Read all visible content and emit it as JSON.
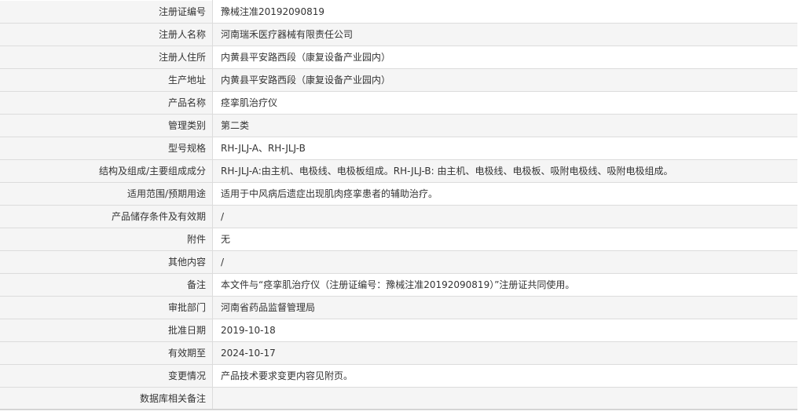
{
  "rows": [
    {
      "label": "注册证编号",
      "value": "豫械注准20192090819"
    },
    {
      "label": "注册人名称",
      "value": "河南瑞禾医疗器械有限责任公司"
    },
    {
      "label": "注册人住所",
      "value": "内黄县平安路西段（康复设备产业园内）"
    },
    {
      "label": "生产地址",
      "value": "内黄县平安路西段（康复设备产业园内）"
    },
    {
      "label": "产品名称",
      "value": "痉挛肌治疗仪"
    },
    {
      "label": "管理类别",
      "value": "第二类"
    },
    {
      "label": "型号规格",
      "value": "RH-JLJ-A、RH-JLJ-B"
    },
    {
      "label": "结构及组成/主要组成成分",
      "value": "RH-JLJ-A:由主机、电极线、电极板组成。RH-JLJ-B: 由主机、电极线、电极板、吸附电极线、吸附电极组成。"
    },
    {
      "label": "适用范围/预期用途",
      "value": "适用于中风病后遗症出现肌肉痉挛患者的辅助治疗。"
    },
    {
      "label": "产品储存条件及有效期",
      "value": "/"
    },
    {
      "label": "附件",
      "value": "无"
    },
    {
      "label": "其他内容",
      "value": "/"
    },
    {
      "label": "备注",
      "value": "本文件与“痉挛肌治疗仪（注册证编号：豫械注准20192090819）”注册证共同使用。"
    },
    {
      "label": "审批部门",
      "value": "河南省药品监督管理局"
    },
    {
      "label": "批准日期",
      "value": "2019-10-18"
    },
    {
      "label": "有效期至",
      "value": "2024-10-17"
    },
    {
      "label": "变更情况",
      "value": "产品技术要求变更内容见附页。"
    },
    {
      "label": "数据库相关备注",
      "value": ""
    }
  ]
}
